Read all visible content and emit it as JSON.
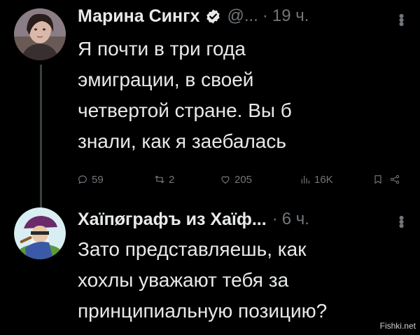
{
  "tweet1": {
    "author_name": "Марина Сингх",
    "handle": "@...",
    "separator": "·",
    "time": "19 ч.",
    "text": "Я почти в три года\nэмиграции, в своей\nчетвертой стране. Вы б\nзнали, как я заебалась",
    "actions": {
      "replies": "59",
      "retweets": "2",
      "likes": "205",
      "views": "16K"
    }
  },
  "tweet2": {
    "author_name": "Хаїпøграфъ из Хаїф...",
    "separator": "·",
    "time": "6 ч.",
    "text": "Зато представляешь, как\nхохлы уважают тебя за\nпринципиальную позицию?"
  },
  "watermark": "Fishki.net",
  "colors": {
    "background": "#000000",
    "text": "#e7e9ea",
    "muted": "#71767b",
    "verified": "#1d9bf0"
  }
}
